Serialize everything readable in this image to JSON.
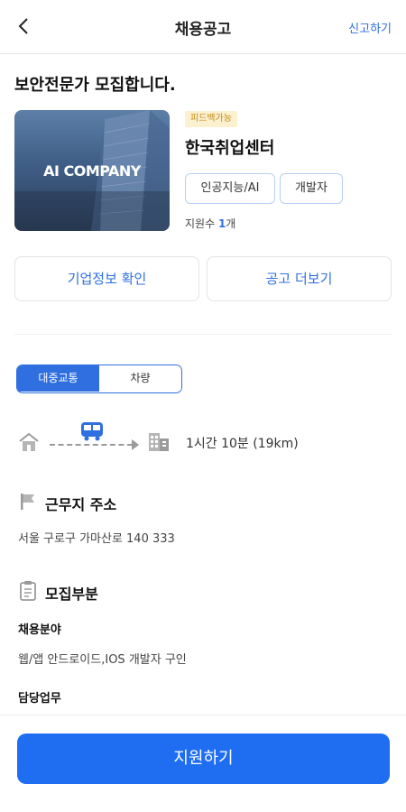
{
  "header": {
    "title": "채용공고",
    "report_label": "신고하기",
    "back_icon": "chevron-left-icon"
  },
  "job": {
    "title": "보안전문가 모집합니다."
  },
  "company": {
    "image_text": "AI COMPANY",
    "badge": "피드백가능",
    "name": "한국취업센터",
    "tags": [
      "인공지능/AI",
      "개발자"
    ],
    "applicants_label": "지원수 ",
    "applicants_count": "1",
    "applicants_unit": "개"
  },
  "actions": {
    "company_info": "기업정보 확인",
    "more_posts": "공고 더보기"
  },
  "transport": {
    "options": [
      "대중교통",
      "차량"
    ],
    "selected": "대중교통",
    "duration": "1시간 10분 (19km)"
  },
  "address_section": {
    "title": "근무지 주소",
    "address": "서울 구로구 가마산로 140 333"
  },
  "recruit_section": {
    "title": "모집부분",
    "field_label": "채용분야",
    "field_value": "웹/앱 안드로이드,IOS 개발자 구인",
    "duty_label": "담당업무"
  },
  "apply_button": "지원하기",
  "colors": {
    "accent": "#2f6fe0",
    "primary_button": "#1f6ef2",
    "badge_bg": "#fcf1cf",
    "badge_text": "#c48a17"
  }
}
